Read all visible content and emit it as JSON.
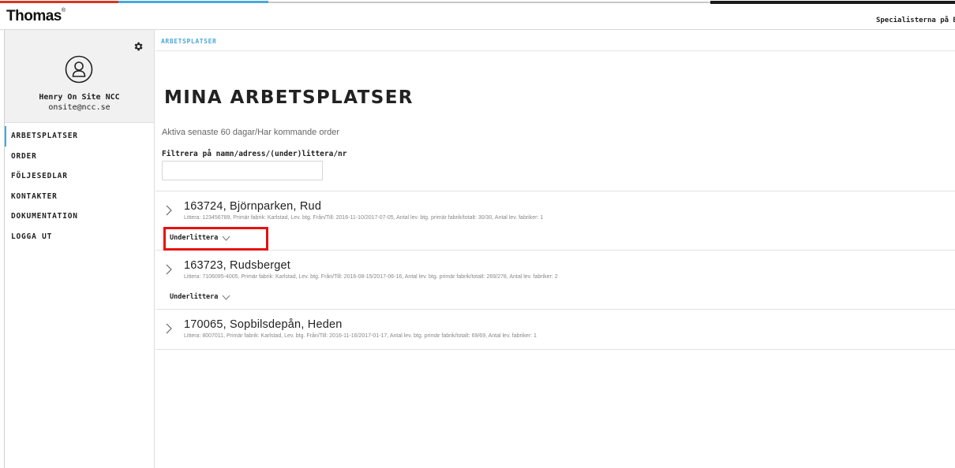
{
  "header": {
    "logo": "Thomas",
    "logo_mark": "®",
    "right_text": "Specialisterna på Betong"
  },
  "sidebar": {
    "user_name": "Henry On Site NCC",
    "user_email": "onsite@ncc.se",
    "items": [
      {
        "label": "ARBETSPLATSER",
        "active": true
      },
      {
        "label": "ORDER"
      },
      {
        "label": "FÖLJESEDLAR"
      },
      {
        "label": "KONTAKTER"
      },
      {
        "label": "DOKUMENTATION"
      },
      {
        "label": "LOGGA UT"
      }
    ]
  },
  "main": {
    "breadcrumb": "ARBETSPLATSER",
    "title": "MINA ARBETSPLATSER",
    "subtitle": "Aktiva senaste 60 dagar/Har kommande order",
    "filter_label": "Filtrera på namn/adress/(under)littera/nr",
    "filter_value": "",
    "sub_label": "Underlittera",
    "items": [
      {
        "title": "163724, Björnparken, Rud",
        "meta": "Littera: 123456789, Primär fabrik: Karlstad, Lev. btg. Från/Till: 2016-11-10/2017-07-05, Antal lev. btg. primär fabrik/totalt: 30/30, Antal lev. fabriker: 1"
      },
      {
        "title": "163723, Rudsberget",
        "meta": "Littera: 7106095-4005, Primär fabrik: Karlstad, Lev. btg. Från/Till: 2016-08-15/2017-06-16, Antal lev. btg. primär fabrik/totalt: 269/278, Antal lev. fabriker: 2"
      },
      {
        "title": "170065, Sopbilsdepån, Heden",
        "meta": "Littera: 8007011, Primär fabrik: Karlstad, Lev. btg. Från/Till: 2016-11-16/2017-01-17, Antal lev. btg. primär fabrik/totalt: 69/69, Antal lev. fabriker: 1"
      }
    ]
  },
  "colors": {
    "accent": "#4aa8d8",
    "highlight": "#e81010",
    "brand_red": "#d9341f"
  },
  "icons": [
    "gear-icon",
    "user-avatar-icon",
    "chevron-right-icon",
    "chevron-down-icon"
  ]
}
